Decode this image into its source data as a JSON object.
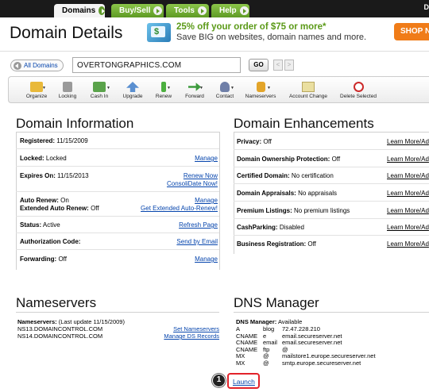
{
  "nav": {
    "tabs": [
      {
        "label": "Domains"
      },
      {
        "label": "Buy/Sell"
      },
      {
        "label": "Tools"
      },
      {
        "label": "Help"
      }
    ],
    "right_text": "D"
  },
  "header": {
    "title": "Domain Details",
    "promo_line1": "25% off your order of $75 or more*",
    "promo_line2": "Save BIG on websites, domain names and more.",
    "shop_button": "SHOP N"
  },
  "domain_bar": {
    "all_domains": "All Domains",
    "domain_value": "OVERTONGRAPHICS.COM",
    "go": "GO",
    "prev": "<",
    "next": ">"
  },
  "toolbar": {
    "items": [
      {
        "label": "Organize",
        "icon": "folder-icon"
      },
      {
        "label": "Locking",
        "icon": "lock-icon"
      },
      {
        "label": "Cash In",
        "icon": "cash-in-icon"
      },
      {
        "label": "Upgrade",
        "icon": "upgrade-icon"
      },
      {
        "label": "Renew",
        "icon": "renew-icon"
      },
      {
        "label": "Forward",
        "icon": "forward-icon"
      },
      {
        "label": "Contact",
        "icon": "contact-icon"
      },
      {
        "label": "Nameservers",
        "icon": "nameservers-icon"
      },
      {
        "label": "Account Change",
        "icon": "account-change-icon"
      },
      {
        "label": "Delete Selected",
        "icon": "delete-icon"
      }
    ]
  },
  "domain_info": {
    "title": "Domain Information",
    "registered_label": "Registered:",
    "registered_value": "11/15/2009",
    "locked_label": "Locked:",
    "locked_value": "Locked",
    "locked_link": "Manage",
    "expires_label": "Expires On:",
    "expires_value": "11/15/2013",
    "renew_link": "Renew Now",
    "consolidate_link": "ConsoliDate Now!",
    "auto_renew_label": "Auto Renew:",
    "auto_renew_value": "On",
    "ext_auto_renew_label": "Extended Auto Renew:",
    "ext_auto_renew_value": "Off",
    "auto_renew_link": "Manage",
    "ext_auto_renew_link": "Get Extended Auto-Renew!",
    "status_label": "Status:",
    "status_value": "Active",
    "status_link": "Refresh Page",
    "auth_label": "Authorization Code:",
    "auth_link": "Send by Email",
    "forwarding_label": "Forwarding:",
    "forwarding_value": "Off",
    "forwarding_link": "Manage"
  },
  "enhancements": {
    "title": "Domain Enhancements",
    "link": "Learn More/Ad",
    "rows": [
      {
        "label": "Privacy:",
        "value": "Off"
      },
      {
        "label": "Domain Ownership Protection:",
        "value": "Off"
      },
      {
        "label": "Certified Domain:",
        "value": "No certification"
      },
      {
        "label": "Domain Appraisals:",
        "value": "No appraisals"
      },
      {
        "label": "Premium Listings:",
        "value": "No premium listings"
      },
      {
        "label": "CashParking:",
        "value": "Disabled"
      },
      {
        "label": "Business Registration:",
        "value": "Off"
      }
    ]
  },
  "nameservers": {
    "title": "Nameservers",
    "label": "Nameservers:",
    "last_update": "(Last update 11/15/2009)",
    "ns1": "NS13.DOMAINCONTROL.COM",
    "ns2": "NS14.DOMAINCONTROL.COM",
    "set_link": "Set Nameservers",
    "ds_link": "Manage DS Records"
  },
  "dns": {
    "title": "DNS Manager",
    "label": "DNS Manager:",
    "value": "Available",
    "records": [
      {
        "type": "A",
        "host": "blog",
        "points": "72.47.228.210"
      },
      {
        "type": "CNAME",
        "host": "e",
        "points": "email.secureserver.net"
      },
      {
        "type": "CNAME",
        "host": "email",
        "points": "email.secureserver.net"
      },
      {
        "type": "CNAME",
        "host": "ftp",
        "points": "@"
      },
      {
        "type": "MX",
        "host": "@",
        "points": "mailstore1.europe.secureserver.net"
      },
      {
        "type": "MX",
        "host": "@",
        "points": "smtp.europe.secureserver.net"
      }
    ],
    "launch": "Launch",
    "callout_number": "1"
  },
  "colors": {
    "nav_green": "#5e9a24",
    "link": "#0645ad",
    "promo_green": "#5b9a18",
    "shop_orange": "#f07c18",
    "callout_red": "#e2222a"
  }
}
